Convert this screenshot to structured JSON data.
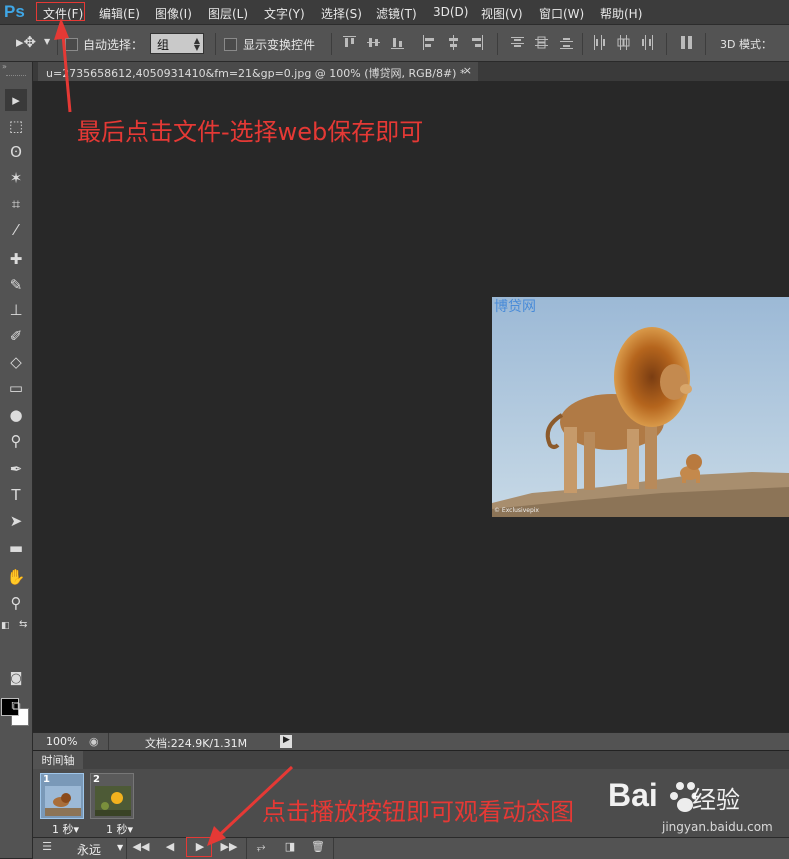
{
  "app": {
    "logo": "Ps",
    "menus": [
      "文件(F)",
      "编辑(E)",
      "图像(I)",
      "图层(L)",
      "文字(Y)",
      "选择(S)",
      "滤镜(T)",
      "3D(D)",
      "视图(V)",
      "窗口(W)",
      "帮助(H)"
    ]
  },
  "options": {
    "auto_select_label": "自动选择：",
    "auto_select_value": "组",
    "show_transform_label": "显示变换控件",
    "mode_3d_label": "3D 模式："
  },
  "document": {
    "tab_title": "u=2735658612,4050931410&fm=21&gp=0.jpg @ 100% (博贷网, RGB/8#) *",
    "close": "×",
    "watermark": "博贷网",
    "credit": "© Exclusivepix"
  },
  "status": {
    "zoom": "100%",
    "doc_info": "文档:224.9K/1.31M"
  },
  "timeline": {
    "tab": "时间轴",
    "frames": [
      {
        "num": "1",
        "delay": "1 秒▾"
      },
      {
        "num": "2",
        "delay": "1 秒▾"
      }
    ],
    "loop": "永远"
  },
  "annotations": {
    "top": "最后点击文件-选择web保存即可",
    "bottom": "点击播放按钮即可观看动态图"
  },
  "watermark_site": {
    "brand": "Bai 经验",
    "jingyan": "经验",
    "url": "jingyan.baidu.com"
  },
  "colors": {
    "annotation": "#e53935",
    "ps_blue": "#3fa6e5"
  }
}
